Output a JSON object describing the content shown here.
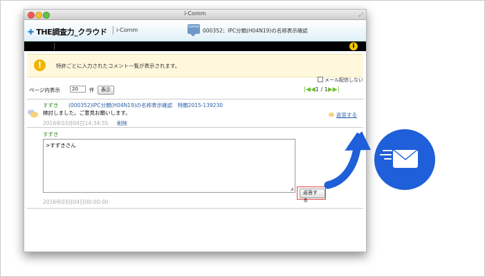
{
  "window": {
    "title": "i-Comm"
  },
  "header": {
    "logo_text": "THE調査力_クラウド",
    "app_name": "i-Comm",
    "doc_icon_label": "Comm",
    "doc_title": "000352：IPC分類(H04N19)の名称表示確認"
  },
  "notice": {
    "text": "特許ごとに入力されたコメント一覧が表示されます。"
  },
  "options": {
    "no_mail_label": "メール配信しない"
  },
  "pager": {
    "label": "ページ内表示",
    "page_size": "20",
    "unit": "件",
    "show_button": "表示",
    "page_indicator": "1 / 1"
  },
  "comment": {
    "author": "すずき",
    "link_text": "(000352)IPC分類(H04N19)の名称表示確認　特願2015-139230",
    "body": "検討しました。ご意見お願いします。",
    "date": "2016年03月04日14:34:55",
    "delete_label": "削除",
    "reply_link": "返答する"
  },
  "reply": {
    "author": "すずき",
    "text": ">すずきさん",
    "submit_label": "返答する",
    "date": "2016年03月04日00:00:00"
  },
  "colors": {
    "mail_badge": "#1f5fd9",
    "highlight": "#dd4444"
  },
  "icons": {
    "mail": "envelope-icon",
    "info": "info-icon",
    "comment": "speech-bubble-icon"
  }
}
